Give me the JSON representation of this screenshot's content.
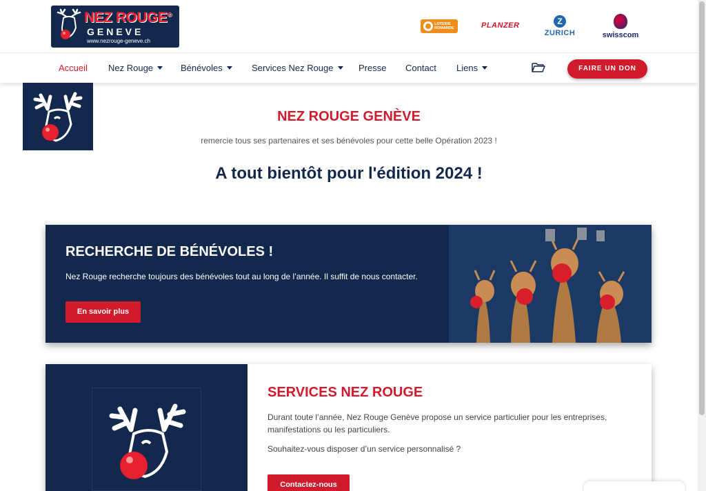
{
  "logo": {
    "title": "NEZ ROUGE",
    "registered": "®",
    "subtitle": "GENEVE",
    "url": "www.nezrouge-geneve.ch"
  },
  "sponsors": [
    {
      "name": "LOTERIE ROMANDE"
    },
    {
      "name": "PLANZER"
    },
    {
      "name": "ZURICH",
      "mark": "Z"
    },
    {
      "name": "swisscom"
    }
  ],
  "nav": {
    "items": [
      {
        "label": "Accueil",
        "dropdown": false,
        "active": true
      },
      {
        "label": "Nez Rouge",
        "dropdown": true
      },
      {
        "label": "Bénévoles",
        "dropdown": true
      },
      {
        "label": "Services Nez Rouge",
        "dropdown": true
      },
      {
        "label": "Presse",
        "dropdown": false
      },
      {
        "label": "Contact",
        "dropdown": false
      },
      {
        "label": "Liens",
        "dropdown": true
      }
    ],
    "folder_icon": "folder-open-icon",
    "donate_label": "FAIRE UN DON"
  },
  "hero": {
    "title": "NEZ ROUGE GENÈVE",
    "subtitle": "remercie tous ses partenaires et ses bénévoles pour cette belle Opération 2023 !",
    "headline": "A tout bientôt pour l'édition 2024 !"
  },
  "volunteers": {
    "title": "RECHERCHE DE BÉNÉVOLES !",
    "text": "Nez Rouge recherche toujours des bénévoles tout au long de l’année. Il suffit de nous contacter.",
    "button": "En savoir plus"
  },
  "services": {
    "title": "SERVICES NEZ ROUGE",
    "text": "Durant toute l’année, Nez Rouge Genève propose un service particulier pour les entreprises, manifestations ou les particuliers.",
    "question": "Souhaitez-vous disposer d’un service personnalisé ?",
    "button": "Contactez-nous"
  },
  "colors": {
    "brand_red": "#d11b2c",
    "brand_navy": "#13284d"
  }
}
